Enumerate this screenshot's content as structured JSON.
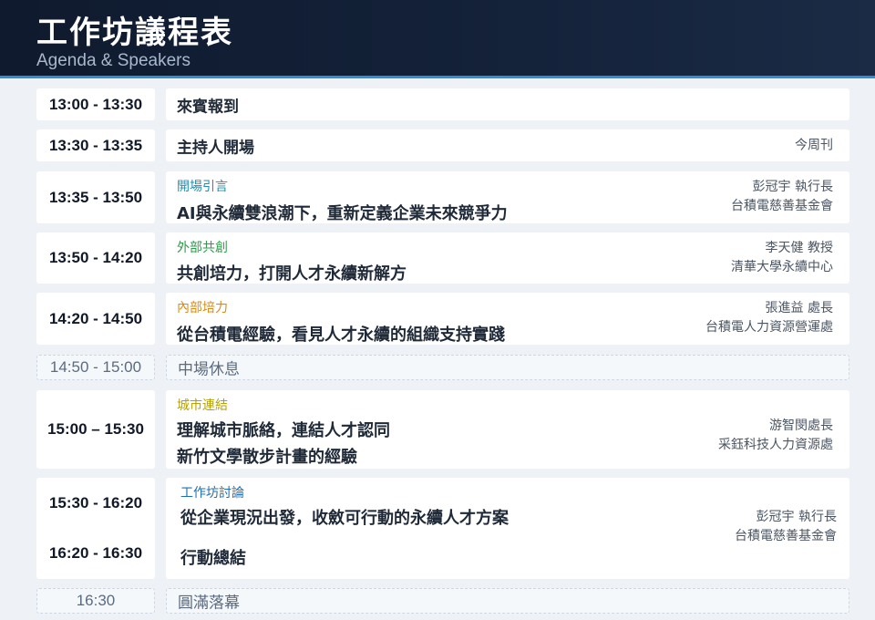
{
  "header": {
    "title": "工作坊議程表",
    "subtitle": "Agenda & Speakers"
  },
  "agenda": [
    {
      "time": "13:00 - 13:30",
      "title": "來賓報到"
    },
    {
      "time": "13:30 - 13:35",
      "title": "主持人開場",
      "speaker": "今周刊"
    },
    {
      "time": "13:35 - 13:50",
      "tag": "開場引言",
      "tag_color": "#1f8fb0",
      "title": "AI與永續雙浪潮下，重新定義企業未來競爭力",
      "speaker_name": "彭冠宇 執行長",
      "speaker_org": "台積電慈善基金會"
    },
    {
      "time": "13:50 - 14:20",
      "tag": "外部共創",
      "tag_color": "#2e9a4a",
      "title": "共創培力，打開人才永續新解方",
      "speaker_name": "李天健 教授",
      "speaker_org": "清華大學永續中心"
    },
    {
      "time": "14:20 - 14:50",
      "tag": "內部培力",
      "tag_color": "#d98a17",
      "title": "從台積電經驗，看見人才永續的組織支持實踐",
      "speaker_name": "張進益 處長",
      "speaker_org": "台積電人力資源營運處"
    },
    {
      "time": "14:50 - 15:00",
      "title": "中場休息"
    },
    {
      "time": "15:00 – 15:30",
      "tag": "城市連結",
      "tag_color": "#b5a300",
      "title_line1": "理解城市脈絡，連結人才認同",
      "title_line2": "新竹文學散步計畫的經驗",
      "speaker_name": "游智閔處長",
      "speaker_org": "采鈺科技人力資源處"
    },
    {
      "time1": "15:30 - 16:20",
      "time2": "16:20 - 16:30",
      "tag": "工作坊討論",
      "tag_color": "#1f6fb0",
      "title_line1": "從企業現況出發，收斂可行動的永續人才方案",
      "title_line2": "行動總結",
      "speaker_name": "彭冠宇 執行長",
      "speaker_org": "台積電慈善基金會"
    },
    {
      "time": "16:30",
      "title": "圓滿落幕"
    }
  ]
}
